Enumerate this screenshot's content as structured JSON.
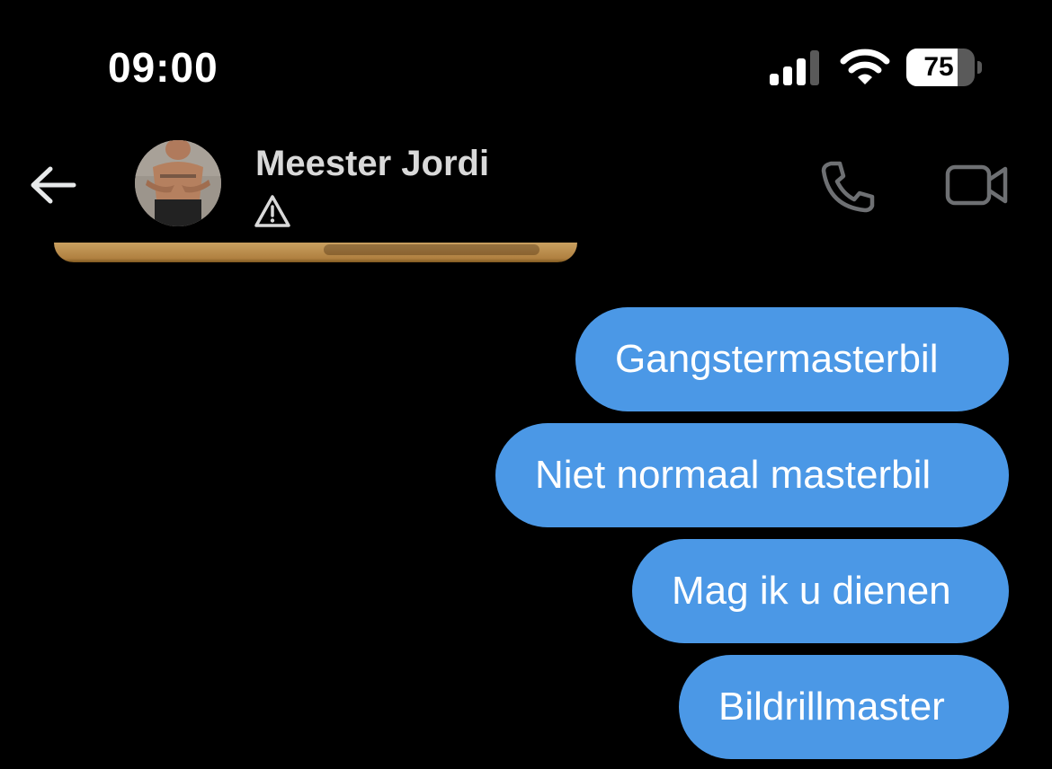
{
  "status_bar": {
    "time": "09:00",
    "battery_level": "75",
    "battery_fraction": 0.75,
    "signal_icon": "cellular-signal-icon",
    "wifi_icon": "wifi-icon"
  },
  "header": {
    "contact_name": "Meester Jordi",
    "back_icon": "arrow-left-icon",
    "warning_icon": "warning-triangle-icon",
    "call_icon": "phone-icon",
    "video_icon": "video-camera-icon"
  },
  "messages": [
    {
      "direction": "sent",
      "text": "Gangstermasterbil"
    },
    {
      "direction": "sent",
      "text": "Niet normaal masterbil"
    },
    {
      "direction": "sent",
      "text": "Mag ik u dienen"
    },
    {
      "direction": "sent",
      "text": "Bildrillmaster"
    }
  ],
  "colors": {
    "background": "#000000",
    "sent_bubble": "#4b98e6",
    "header_icons": "#6e7073",
    "name_text": "#d9d9d9"
  }
}
